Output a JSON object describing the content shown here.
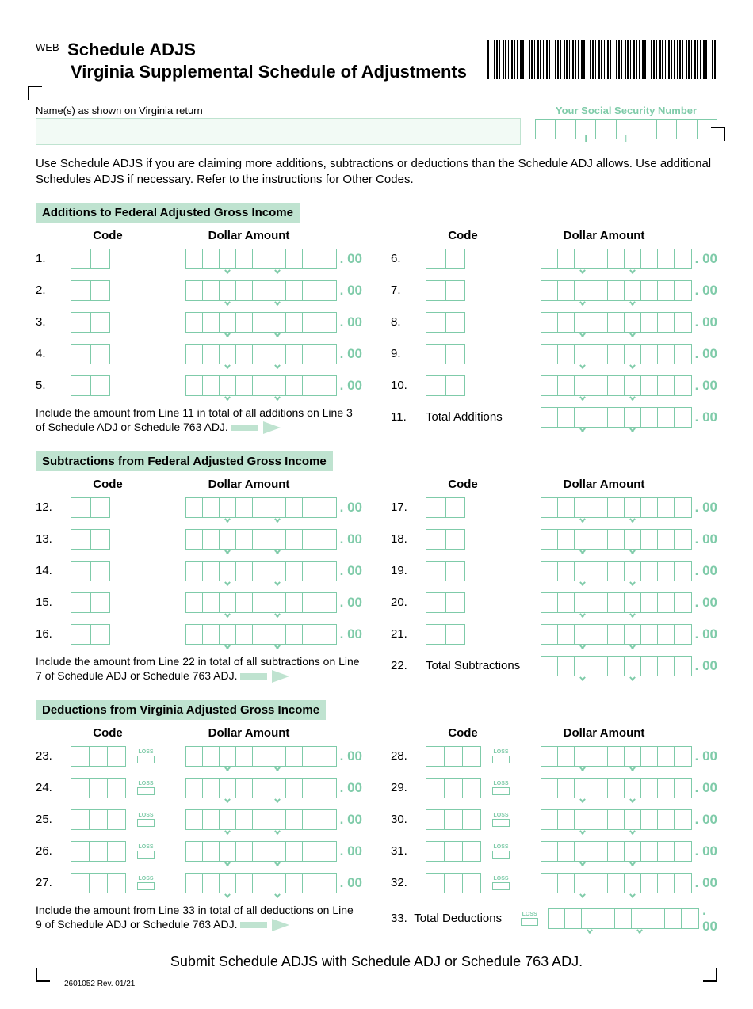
{
  "web": "WEB",
  "title": "Schedule ADJS",
  "subtitle": "Virginia Supplemental Schedule of Adjustments",
  "nameLabel": "Name(s) as shown on Virginia return",
  "ssnLabel": "Your Social Security Number",
  "intro": "Use Schedule ADJS if you are claiming more additions, subtractions or deductions than the Schedule ADJ allows.  Use additional Schedules ADJS if necessary.  Refer to the instructions for Other Codes.",
  "sections": {
    "additions": {
      "header": "Additions to Federal Adjusted Gross Income",
      "codeHdr": "Code",
      "amtHdr": "Dollar Amount",
      "left": [
        "1.",
        "2.",
        "3.",
        "4.",
        "5."
      ],
      "right": [
        "6.",
        "7.",
        "8.",
        "9.",
        "10."
      ],
      "totalNum": "11.",
      "totalLabel": "Total Additions",
      "note": "Include the  amount from Line 11 in total of all additions on Line 3 of Schedule ADJ or Schedule 763 ADJ."
    },
    "subtractions": {
      "header": "Subtractions from Federal Adjusted Gross Income",
      "codeHdr": "Code",
      "amtHdr": "Dollar Amount",
      "left": [
        "12.",
        "13.",
        "14.",
        "15.",
        "16."
      ],
      "right": [
        "17.",
        "18.",
        "19.",
        "20.",
        "21."
      ],
      "totalNum": "22.",
      "totalLabel": "Total Subtractions",
      "note": "Include the amount from Line 22 in total of all subtractions on Line 7 of Schedule ADJ or Schedule 763 ADJ."
    },
    "deductions": {
      "header": "Deductions from Virginia Adjusted Gross Income",
      "codeHdr": "Code",
      "amtHdr": "Dollar Amount",
      "left": [
        "23.",
        "24.",
        "25.",
        "26.",
        "27."
      ],
      "right": [
        "28.",
        "29.",
        "30.",
        "31.",
        "32."
      ],
      "totalNum": "33.",
      "totalLabel": "Total Deductions",
      "note": "Include the amount from Line 33 in total of all deductions on Line 9 of Schedule ADJ or Schedule 763 ADJ."
    }
  },
  "loss": "LOSS",
  "cents": ". 00",
  "submit": "Submit Schedule ADJS with Schedule ADJ or Schedule 763 ADJ.",
  "footer": "2601052  Rev. 01/21"
}
